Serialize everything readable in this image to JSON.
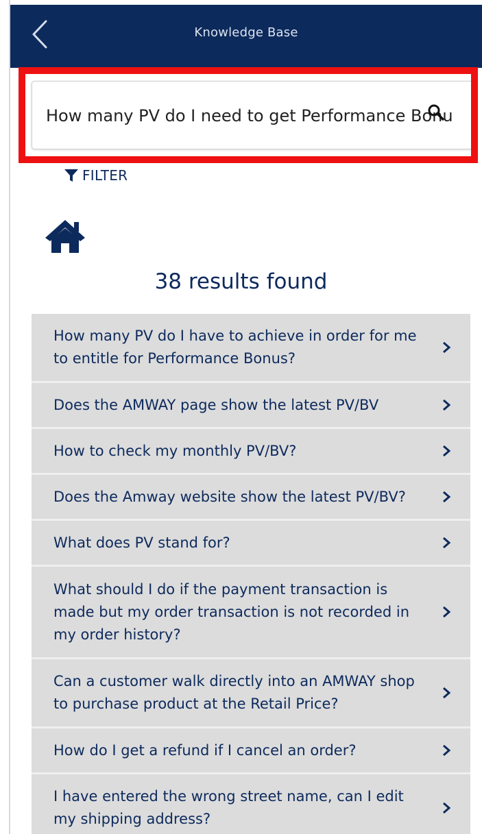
{
  "header": {
    "title": "Knowledge Base",
    "back_icon": "back-chevron-icon",
    "background_color": "#0d2a5c"
  },
  "search": {
    "value": "How many PV do I need to get Performance Bonu",
    "icon": "search-icon",
    "highlight_color": "#ee1111"
  },
  "filter": {
    "label": "FILTER",
    "icon": "filter-funnel-icon"
  },
  "home": {
    "icon": "home-icon"
  },
  "results": {
    "count_text": "38 results found",
    "list_background": "#dcdcdc",
    "text_color": "#0d2a5c",
    "items": [
      {
        "label": "How many PV do I have to achieve in order for me to entitle for Performance Bonus?"
      },
      {
        "label": "Does the AMWAY page show the latest PV/BV"
      },
      {
        "label": "How to check my monthly PV/BV?"
      },
      {
        "label": "Does the Amway website show the latest PV/BV?"
      },
      {
        "label": "What does PV stand for?"
      },
      {
        "label": "What should I do if the payment transaction is made but my order transaction is not recorded in my order history?"
      },
      {
        "label": "Can a customer walk directly into an AMWAY shop to purchase product at the Retail Price?"
      },
      {
        "label": "How do I get a refund if I cancel an order?"
      },
      {
        "label": "I have entered the wrong street name, can I edit my shipping address?"
      }
    ]
  }
}
